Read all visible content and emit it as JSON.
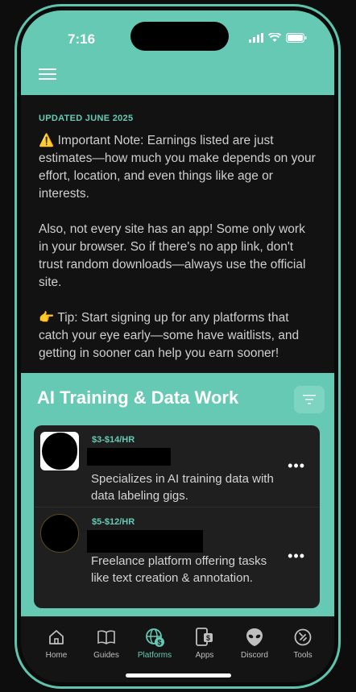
{
  "status": {
    "time": "7:16"
  },
  "header": {
    "menu_icon": "hamburger-icon"
  },
  "intro": {
    "updated": "UPDATED JUNE 2025",
    "note": "⚠️ Important Note: Earnings listed are just estimates—how much you make depends on your effort, location, and even things like age or interests.",
    "apps": "Also, not every site has an app! Some only work in your browser. So if there's no app link, don't trust random downloads—always use the official site.",
    "tip": "👉 Tip: Start signing up for any platforms that catch your eye early—some have waitlists, and getting in sooner can help you earn sooner!"
  },
  "section": {
    "title": "AI Training & Data Work",
    "filter_icon": "filter-icon",
    "items": [
      {
        "rate": "$3-$14/HR",
        "name": "",
        "description": "Specializes in AI training data with data labeling gigs.",
        "more": "•••"
      },
      {
        "rate": "$5-$12/HR",
        "name": "",
        "description": "Freelance platform offering tasks like text creation & annotation.",
        "more": "•••"
      }
    ]
  },
  "tabs": [
    {
      "label": "Home",
      "icon": "home-icon"
    },
    {
      "label": "Guides",
      "icon": "book-icon"
    },
    {
      "label": "Platforms",
      "icon": "globe-dollar-icon",
      "active": true
    },
    {
      "label": "Apps",
      "icon": "phone-dollar-icon"
    },
    {
      "label": "Discord",
      "icon": "alien-icon"
    },
    {
      "label": "Tools",
      "icon": "tools-icon"
    }
  ],
  "colors": {
    "accent": "#66c9b4",
    "background": "#121212",
    "card": "#1f1f1f"
  }
}
